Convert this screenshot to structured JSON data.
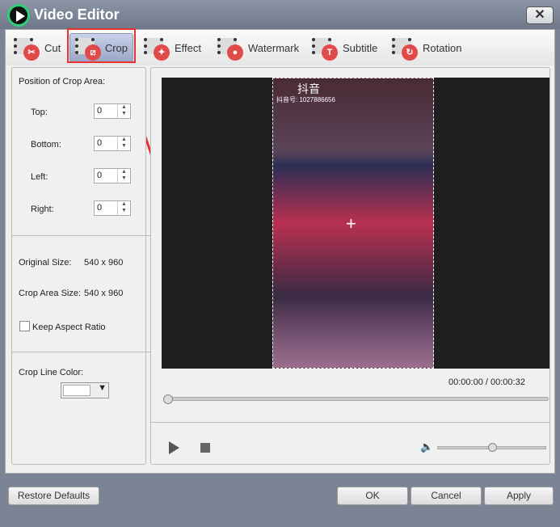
{
  "window": {
    "title": "Video Editor",
    "close_label": "✕"
  },
  "tabs": [
    {
      "label": "Cut",
      "icon": "✂"
    },
    {
      "label": "Crop",
      "icon": "⧄"
    },
    {
      "label": "Effect",
      "icon": "✦"
    },
    {
      "label": "Watermark",
      "icon": "●"
    },
    {
      "label": "Subtitle",
      "icon": "T"
    },
    {
      "label": "Rotation",
      "icon": "↻"
    }
  ],
  "crop": {
    "section_title": "Position of Crop Area:",
    "top_label": "Top:",
    "top": "0",
    "bottom_label": "Bottom:",
    "bottom": "0",
    "left_label": "Left:",
    "left": "0",
    "right_label": "Right:",
    "right": "0",
    "original_size_label": "Original Size:",
    "original_size": "540 x 960",
    "crop_size_label": "Crop Area Size:",
    "crop_size": "540 x 960",
    "keep_aspect_label": "Keep Aspect Ratio",
    "keep_aspect": false,
    "line_color_label": "Crop Line Color:",
    "line_color": "#ffffff"
  },
  "video": {
    "overlay_app": "抖音",
    "overlay_id": "抖音号: 1027886656",
    "time_current": "00:00:00",
    "time_separator": "/",
    "time_total": "00:00:32",
    "progress": 0,
    "volume": 0.5
  },
  "footer": {
    "restore": "Restore Defaults",
    "ok": "OK",
    "cancel": "Cancel",
    "apply": "Apply"
  }
}
